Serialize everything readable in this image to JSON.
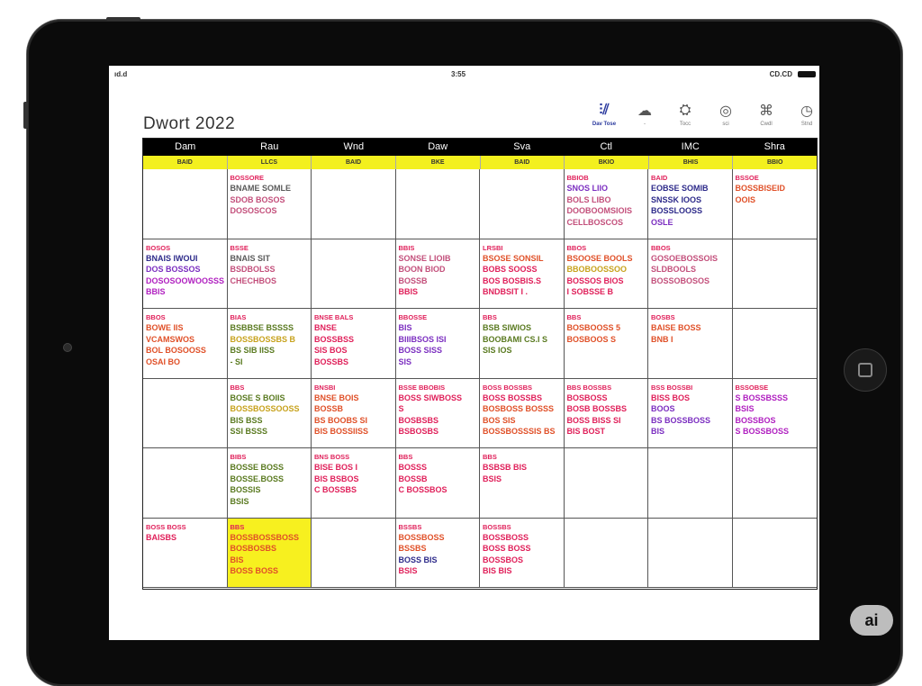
{
  "status_bar": {
    "left": "ıd.d",
    "center": "3:55",
    "right": "CD.CD"
  },
  "calendar_title": "Dwort 2022",
  "toolbar": [
    {
      "icon": "grid-icon",
      "glyph": "⫶⫽",
      "label": "Dav Tose",
      "active": true
    },
    {
      "icon": "cloud-icon",
      "glyph": "☁",
      "label": "-",
      "active": false
    },
    {
      "icon": "tools-icon",
      "glyph": "⛭",
      "label": "Tocc",
      "active": false
    },
    {
      "icon": "camera-icon",
      "glyph": "◎",
      "label": "sci",
      "active": false
    },
    {
      "icon": "tag-icon",
      "glyph": "⌘",
      "label": "Cwdl",
      "active": false
    },
    {
      "icon": "clock-icon",
      "glyph": "◷",
      "label": "Stnd",
      "active": false
    }
  ],
  "days": [
    "Dam",
    "Rau",
    "Wnd",
    "Daw",
    "Sva",
    "Ctl",
    "IMC",
    "Shra"
  ],
  "day_sub": [
    "BAID",
    "LLCS",
    "BAID",
    "BKE",
    "BAID",
    "BKIO",
    "BHIS",
    "BBIO"
  ],
  "weeks": [
    [
      {
        "lines": []
      },
      {
        "lines": [
          {
            "t": "BOSSORE",
            "c": "#e0205a",
            "h": true
          },
          {
            "t": "BNAME SOMLE",
            "c": "#5a5a5a"
          },
          {
            "t": "SDOB BOSOS",
            "c": "#c34f7b"
          },
          {
            "t": "DOSOSCOS",
            "c": "#c34f7b"
          }
        ]
      },
      {
        "lines": []
      },
      {
        "lines": []
      },
      {
        "lines": []
      },
      {
        "lines": [
          {
            "t": "BBIOB",
            "c": "#e0205a",
            "h": true
          },
          {
            "t": "SNOS LIIO",
            "c": "#7b2ec0"
          },
          {
            "t": "BOLS LIBO",
            "c": "#c34f7b"
          },
          {
            "t": "DOOBOOMSIOIS",
            "c": "#c34f7b"
          },
          {
            "t": "CELLBOSCOS",
            "c": "#c34f7b"
          }
        ]
      },
      {
        "lines": [
          {
            "t": "BAID",
            "c": "#e0205a",
            "h": true
          },
          {
            "t": "EOBSE SOMIB",
            "c": "#2d2a8a"
          },
          {
            "t": "SNSSK IOOS",
            "c": "#2d2a8a"
          },
          {
            "t": "BOSSLOOSS",
            "c": "#2d2a8a"
          },
          {
            "t": "OSLE",
            "c": "#7b2ec0"
          }
        ]
      },
      {
        "lines": [
          {
            "t": "BSSOE",
            "c": "#e0205a",
            "h": true
          },
          {
            "t": "BOSSBISEID",
            "c": "#e05028"
          },
          {
            "t": "OOIS",
            "c": "#e05028"
          }
        ]
      }
    ],
    [
      {
        "lines": [
          {
            "t": "BOSOS",
            "c": "#e0205a",
            "h": true
          },
          {
            "t": "BNAIS IWOUI",
            "c": "#2d2a8a"
          },
          {
            "t": "DOS BOSSOS",
            "c": "#7b2ec0"
          },
          {
            "t": "DOSOSOOWOOSSS",
            "c": "#b020c0"
          },
          {
            "t": "BBIS",
            "c": "#b020c0"
          }
        ]
      },
      {
        "lines": [
          {
            "t": "BSSE",
            "c": "#e0205a",
            "h": true
          },
          {
            "t": "BNAIS SIT",
            "c": "#5a5a5a"
          },
          {
            "t": "BSDBOLSS",
            "c": "#c34f7b"
          },
          {
            "t": "CHECHBOS",
            "c": "#c34f7b"
          }
        ]
      },
      {
        "lines": []
      },
      {
        "lines": [
          {
            "t": "BBIS",
            "c": "#e0205a",
            "h": true
          },
          {
            "t": "SONSE LIOIB",
            "c": "#c34f7b"
          },
          {
            "t": "BOON BIOD",
            "c": "#c34f7b"
          },
          {
            "t": "BOSSB",
            "c": "#c34f7b"
          },
          {
            "t": "BBIS",
            "c": "#e0205a"
          }
        ]
      },
      {
        "lines": [
          {
            "t": "LRSBI",
            "c": "#e0205a",
            "h": true
          },
          {
            "t": "BSOSE SONSIL",
            "c": "#e05028"
          },
          {
            "t": "BOBS SOOSS",
            "c": "#e0205a"
          },
          {
            "t": "BOS BOSBIS.S",
            "c": "#e0205a"
          },
          {
            "t": "BNDBSIT I .",
            "c": "#e0205a"
          }
        ]
      },
      {
        "lines": [
          {
            "t": "BBOS",
            "c": "#e0205a",
            "h": true
          },
          {
            "t": "BSOOSE BOOLS",
            "c": "#e05028"
          },
          {
            "t": "BBOBOOSSOO",
            "c": "#c7a21c"
          },
          {
            "t": "BOSSOS BIOS",
            "c": "#e0205a"
          },
          {
            "t": "I SOBSSE B",
            "c": "#e0205a"
          }
        ]
      },
      {
        "lines": [
          {
            "t": "BBOS",
            "c": "#e0205a",
            "h": true
          },
          {
            "t": "GOSOEBOSSOIS",
            "c": "#c34f7b"
          },
          {
            "t": "SLDBOOLS",
            "c": "#c34f7b"
          },
          {
            "t": "BOSSOBOSOS",
            "c": "#c34f7b"
          }
        ]
      },
      {
        "lines": []
      }
    ],
    [
      {
        "lines": [
          {
            "t": "BBOS",
            "c": "#e0205a",
            "h": true
          },
          {
            "t": "BOWE IIS",
            "c": "#e05028"
          },
          {
            "t": "VCAMSWOS",
            "c": "#e05028"
          },
          {
            "t": "BOL BOSOOSS",
            "c": "#e05028"
          },
          {
            "t": "OSAI BO",
            "c": "#e05028"
          }
        ]
      },
      {
        "lines": [
          {
            "t": "BIAS",
            "c": "#e0205a",
            "h": true
          },
          {
            "t": "BSBBSE BSSSS",
            "c": "#5a7a20"
          },
          {
            "t": "BOSSBOSSBS B",
            "c": "#c7a21c"
          },
          {
            "t": "BS SIB IISS",
            "c": "#5a7a20"
          },
          {
            "t": "- SI",
            "c": "#5a7a20"
          }
        ]
      },
      {
        "lines": [
          {
            "t": "BNSE BALS",
            "c": "#e0205a",
            "h": true
          },
          {
            "t": "BNSE",
            "c": "#e0205a"
          },
          {
            "t": "BOSSBSS",
            "c": "#e0205a"
          },
          {
            "t": "SIS BOS",
            "c": "#e0205a"
          },
          {
            "t": "BOSSBS",
            "c": "#e0205a"
          }
        ]
      },
      {
        "lines": [
          {
            "t": "BBOSSE",
            "c": "#e0205a",
            "h": true
          },
          {
            "t": "BIS",
            "c": "#7b2ec0"
          },
          {
            "t": "BIIIBSOS ISI",
            "c": "#7b2ec0"
          },
          {
            "t": "BOSS SISS",
            "c": "#7b2ec0"
          },
          {
            "t": "SIS",
            "c": "#7b2ec0"
          }
        ]
      },
      {
        "lines": [
          {
            "t": "BBS",
            "c": "#e0205a",
            "h": true
          },
          {
            "t": "BSB SIWIOS",
            "c": "#5a7a20"
          },
          {
            "t": "BOOBAMI CS.I S",
            "c": "#5a7a20"
          },
          {
            "t": "SIS IOS",
            "c": "#5a7a20"
          }
        ]
      },
      {
        "lines": [
          {
            "t": "BBS",
            "c": "#e0205a",
            "h": true
          },
          {
            "t": "BOSBOOSS 5",
            "c": "#e05028"
          },
          {
            "t": "BOSBOOS S",
            "c": "#e05028"
          }
        ]
      },
      {
        "lines": [
          {
            "t": "BOSBS",
            "c": "#e0205a",
            "h": true
          },
          {
            "t": "BAISE BOSS",
            "c": "#e05028"
          },
          {
            "t": "BNB I",
            "c": "#e05028"
          }
        ]
      },
      {
        "lines": []
      }
    ],
    [
      {
        "lines": []
      },
      {
        "lines": [
          {
            "t": "BBS",
            "c": "#e0205a",
            "h": true
          },
          {
            "t": "BOSE S BOIIS",
            "c": "#5a7a20"
          },
          {
            "t": "BOSSBOSSOOSS",
            "c": "#c7a21c"
          },
          {
            "t": "BIS BSS",
            "c": "#5a7a20"
          },
          {
            "t": "SSI BSSS",
            "c": "#5a7a20"
          }
        ]
      },
      {
        "lines": [
          {
            "t": "BNSBI",
            "c": "#e0205a",
            "h": true
          },
          {
            "t": "BNSE BOIS",
            "c": "#e05028"
          },
          {
            "t": "BOSSB",
            "c": "#e05028"
          },
          {
            "t": "BS BOOBS SI",
            "c": "#e05028"
          },
          {
            "t": "BIS BOSSIISS",
            "c": "#e05028"
          }
        ]
      },
      {
        "lines": [
          {
            "t": "BSSE BBOBIS",
            "c": "#e0205a",
            "h": true
          },
          {
            "t": "BOSS SIWBOSS",
            "c": "#e0205a"
          },
          {
            "t": "S",
            "c": "#e0205a"
          },
          {
            "t": "BOSBSBS",
            "c": "#e0205a"
          },
          {
            "t": "BSBOSBS",
            "c": "#e0205a"
          }
        ]
      },
      {
        "lines": [
          {
            "t": "BOSS BOSSBS",
            "c": "#e0205a",
            "h": true
          },
          {
            "t": "BOSS BOSSBS",
            "c": "#e0205a"
          },
          {
            "t": "BOSBOSS BOSSS",
            "c": "#e05028"
          },
          {
            "t": "BOS SIS",
            "c": "#e05028"
          },
          {
            "t": "BOSSBOSSSIS BS",
            "c": "#e05028"
          }
        ]
      },
      {
        "lines": [
          {
            "t": "BBS BOSSBS",
            "c": "#e0205a",
            "h": true
          },
          {
            "t": "BOSBOSS",
            "c": "#e0205a"
          },
          {
            "t": "BOSB BOSSBS",
            "c": "#e0205a"
          },
          {
            "t": "BOSS BISS SI",
            "c": "#e0205a"
          },
          {
            "t": "BIS BOST",
            "c": "#e0205a"
          }
        ]
      },
      {
        "lines": [
          {
            "t": "BSS BOSSBI",
            "c": "#e0205a",
            "h": true
          },
          {
            "t": "BISS BOS",
            "c": "#e0205a"
          },
          {
            "t": "BOOS",
            "c": "#7b2ec0"
          },
          {
            "t": "BS BOSSBOSS",
            "c": "#7b2ec0"
          },
          {
            "t": "BIS",
            "c": "#7b2ec0"
          }
        ]
      },
      {
        "lines": [
          {
            "t": "BSSOBSE",
            "c": "#e0205a",
            "h": true
          },
          {
            "t": "S BOSSBSSS",
            "c": "#b020c0"
          },
          {
            "t": "BSIS",
            "c": "#b020c0"
          },
          {
            "t": "BOSSBOS",
            "c": "#b020c0"
          },
          {
            "t": "S BOSSBOSS",
            "c": "#b020c0"
          }
        ]
      }
    ],
    [
      {
        "lines": []
      },
      {
        "lines": [
          {
            "t": "BIBS",
            "c": "#e0205a",
            "h": true
          },
          {
            "t": "BOSSE BOSS",
            "c": "#5a7a20"
          },
          {
            "t": "BOSSE.BOSS",
            "c": "#5a7a20"
          },
          {
            "t": "BOSSIS",
            "c": "#5a7a20"
          },
          {
            "t": "BSIS",
            "c": "#5a7a20"
          }
        ]
      },
      {
        "lines": [
          {
            "t": "BNS BOSS",
            "c": "#e0205a",
            "h": true
          },
          {
            "t": "BISE BOS I",
            "c": "#e0205a"
          },
          {
            "t": "BIS BSBOS",
            "c": "#e0205a"
          },
          {
            "t": "C BOSSBS",
            "c": "#e0205a"
          }
        ]
      },
      {
        "lines": [
          {
            "t": "BBS",
            "c": "#e0205a",
            "h": true
          },
          {
            "t": "BOSSS",
            "c": "#e0205a"
          },
          {
            "t": "BOSSB",
            "c": "#e0205a"
          },
          {
            "t": "C BOSSBOS",
            "c": "#e0205a"
          }
        ]
      },
      {
        "lines": [
          {
            "t": "BBS",
            "c": "#e0205a",
            "h": true
          },
          {
            "t": "BSBSB BIS",
            "c": "#e0205a"
          },
          {
            "t": "BSIS",
            "c": "#e0205a"
          }
        ]
      },
      {
        "lines": []
      },
      {
        "lines": []
      },
      {
        "lines": []
      }
    ],
    [
      {
        "lines": [
          {
            "t": "BOSS BOSS",
            "c": "#e0205a",
            "h": true
          },
          {
            "t": "BAISBS",
            "c": "#e0205a"
          }
        ]
      },
      {
        "yellow": true,
        "lines": [
          {
            "t": "BBS",
            "c": "#e0205a",
            "h": true
          },
          {
            "t": "BOSSBOSSBOSS",
            "c": "#e05028"
          },
          {
            "t": "BOSBOSBS",
            "c": "#e05028"
          },
          {
            "t": "BIS",
            "c": "#e05028"
          },
          {
            "t": "BOSS BOSS",
            "c": "#e05028"
          }
        ]
      },
      {
        "lines": []
      },
      {
        "lines": [
          {
            "t": "BSSBS",
            "c": "#e0205a",
            "h": true
          },
          {
            "t": "BOSSBOSS",
            "c": "#e05028"
          },
          {
            "t": "BSSBS",
            "c": "#e05028"
          },
          {
            "t": "BOSS BIS",
            "c": "#2d2a8a"
          },
          {
            "t": "BSIS",
            "c": "#e0205a"
          }
        ]
      },
      {
        "lines": [
          {
            "t": "BOSSBS",
            "c": "#e0205a",
            "h": true
          },
          {
            "t": "BOSSBOSS",
            "c": "#e0205a"
          },
          {
            "t": "BOSS BOSS",
            "c": "#e0205a"
          },
          {
            "t": "BOSSBOS",
            "c": "#e0205a"
          },
          {
            "t": "BIS BIS",
            "c": "#e0205a"
          }
        ]
      },
      {
        "lines": []
      },
      {
        "lines": []
      },
      {
        "lines": []
      }
    ]
  ],
  "ai_badge": "ai"
}
